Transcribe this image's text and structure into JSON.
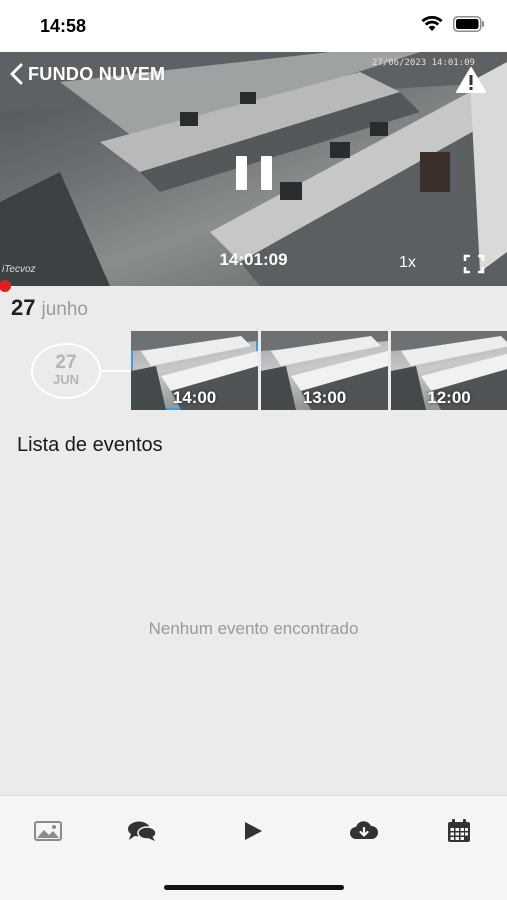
{
  "status_bar": {
    "time": "14:58"
  },
  "header": {
    "back_label": "FUNDO NUVEM",
    "overlay_date": "27/06/2023 14:01:09"
  },
  "player": {
    "timestamp": "14:01:09",
    "speed": "1x",
    "camera_label": "iTecvoz",
    "progress": 0.0
  },
  "date_header": {
    "day": "27",
    "month": "junho"
  },
  "date_circle": {
    "day": "27",
    "month": "JUN"
  },
  "thumbnails": [
    {
      "label": "14:00",
      "selected": true
    },
    {
      "label": "13:00",
      "selected": false
    },
    {
      "label": "12:00",
      "selected": false
    }
  ],
  "events": {
    "title": "Lista de eventos",
    "empty_message": "Nenhum evento encontrado"
  },
  "tabs": [
    {
      "icon": "image-icon"
    },
    {
      "icon": "chat-icon"
    },
    {
      "icon": "play-icon"
    },
    {
      "icon": "cloud-download-icon"
    },
    {
      "icon": "calendar-icon"
    }
  ],
  "colors": {
    "accent": "#3aa0e0",
    "progress": "#e02020"
  }
}
